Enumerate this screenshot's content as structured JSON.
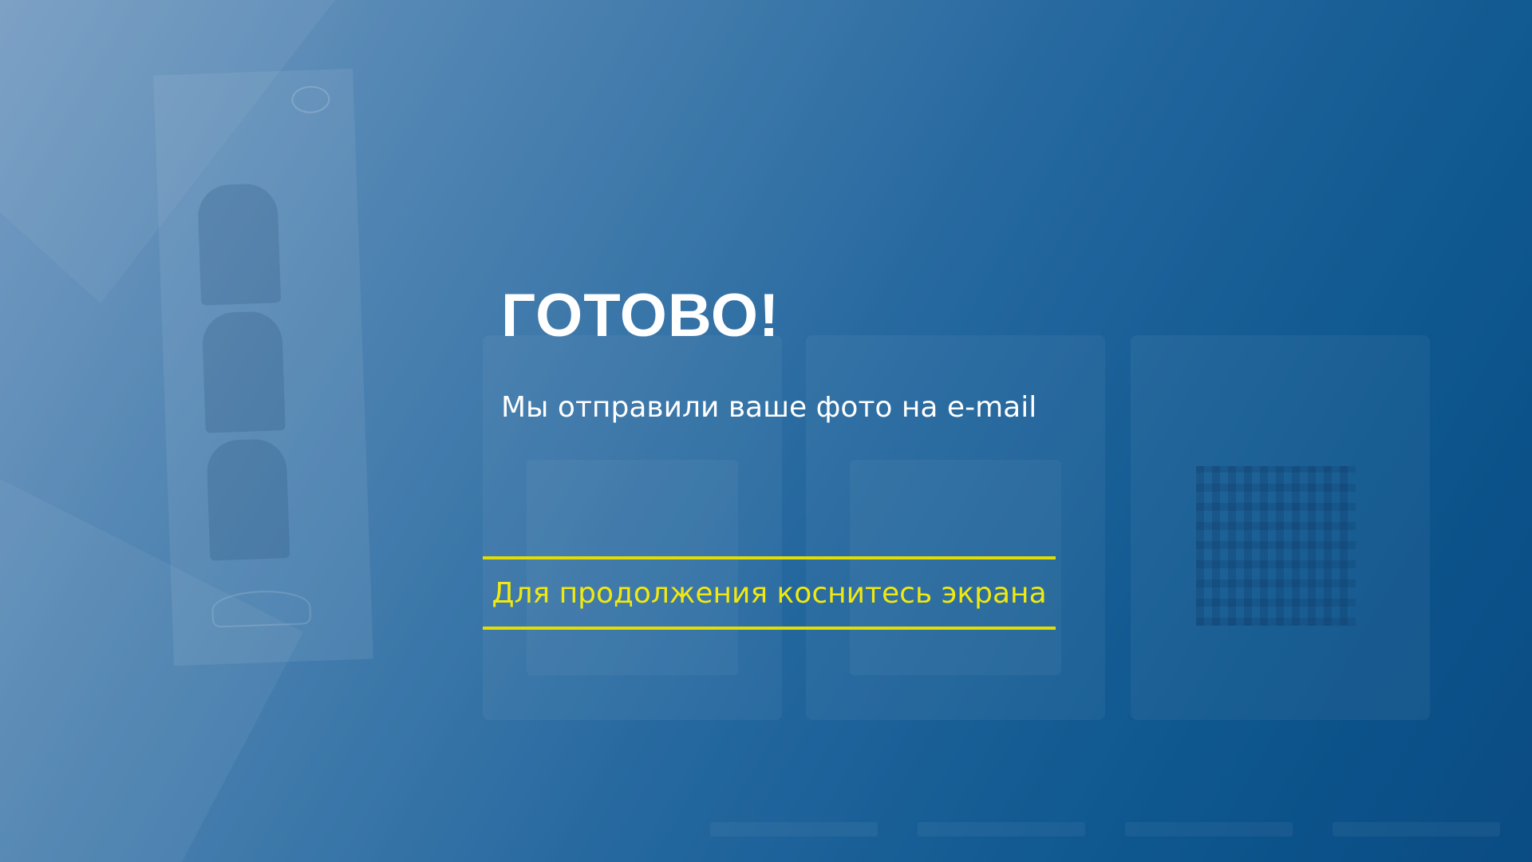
{
  "modal": {
    "title": "ГОТОВО!",
    "message": "Мы отправили ваше фото на e-mail"
  },
  "continue": {
    "label": "Для продолжения коснитесь экрана",
    "accent": "#e4de00"
  },
  "colors": {
    "background_light": "#8fb0d2",
    "background_dark": "#0a4d84",
    "text": "#ffffff"
  }
}
